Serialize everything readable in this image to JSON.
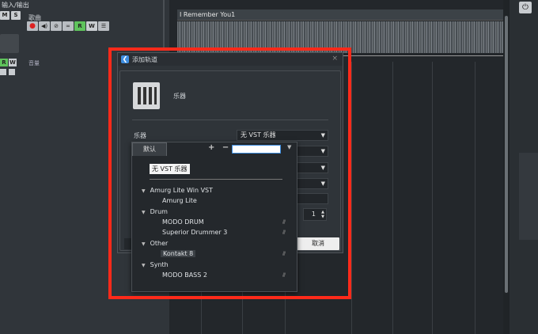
{
  "inspector": {
    "io_label": "输入/输出",
    "m_label": "M",
    "s_label": "S",
    "track_name": "歌曲",
    "r_label": "R",
    "w_label": "W",
    "column_header": "音量",
    "small_r": "R",
    "small_w": "W"
  },
  "arrange": {
    "clip_title": "I Remember You1"
  },
  "dialog": {
    "title": "添加轨道",
    "close_glyph": "×",
    "instrument_label": "乐器",
    "row_label": "乐器",
    "selected_instrument": "无 VST 乐器",
    "count": "1",
    "cancel_label": "取消"
  },
  "popup": {
    "tab_label": "默认",
    "plus": "+",
    "minus": "−",
    "none_item": "无 VST 乐器",
    "groups": [
      {
        "name": "Amurg Lite Win VST",
        "items": [
          "Amurg Lite"
        ]
      },
      {
        "name": "Drum",
        "items": [
          "MODO DRUM",
          "Superior Drummer 3"
        ]
      },
      {
        "name": "Other",
        "items": [
          "Kontakt 8"
        ]
      },
      {
        "name": "Synth",
        "items": [
          "MODO BASS 2"
        ]
      }
    ],
    "marks": "///"
  }
}
